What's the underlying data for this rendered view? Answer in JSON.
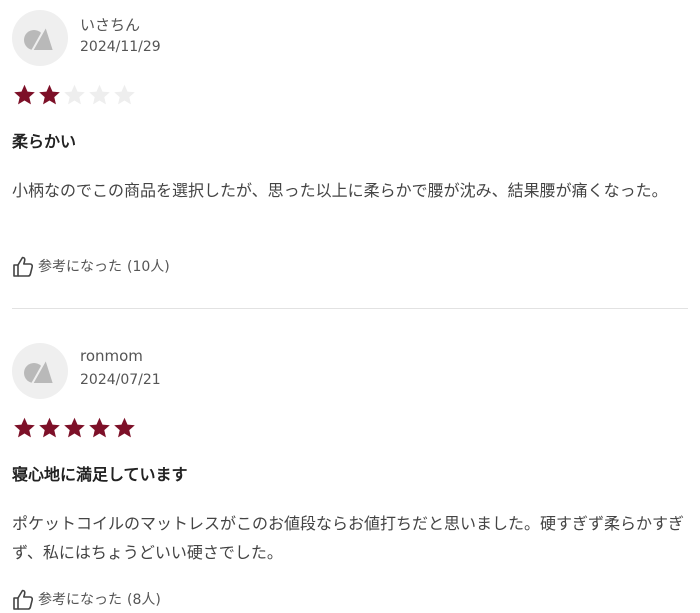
{
  "reviews": [
    {
      "reviewer": "いさちん",
      "date": "2024/11/29",
      "rating": 2,
      "max_rating": 5,
      "title": "柔らかい",
      "body": "小柄なのでこの商品を選択したが、思った以上に柔らかで腰が沈み、結果腰が痛くなった。",
      "helpful_label": "参考になった",
      "helpful_count": "(10人)"
    },
    {
      "reviewer": "ronmom",
      "date": "2024/07/21",
      "rating": 5,
      "max_rating": 5,
      "title": "寝心地に満足しています",
      "body": "ポケットコイルのマットレスがこのお値段ならお値打ちだと思いました。硬すぎず柔らかすぎず、私にはちょうどいい硬さでした。",
      "helpful_label": "参考になった",
      "helpful_count": "(8人)"
    }
  ],
  "colors": {
    "star_filled": "#7d1028",
    "star_empty": "#eeeeee",
    "avatar_bg": "#efefef",
    "avatar_icon": "#b9b9b9"
  },
  "icons": {
    "avatar": "user-avatar-icon",
    "star": "star-icon",
    "helpful": "thumbs-up-icon"
  }
}
